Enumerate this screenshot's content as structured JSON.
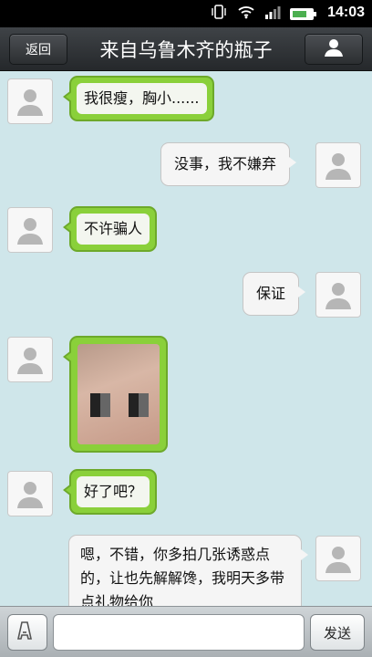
{
  "status_bar": {
    "time": "14:03",
    "icons": [
      "vibrate-icon",
      "wifi-icon",
      "signal-icon",
      "battery-icon"
    ]
  },
  "header": {
    "back_label": "返回",
    "title": "来自乌鲁木齐的瓶子",
    "profile_icon": "person-icon"
  },
  "messages": [
    {
      "side": "in",
      "text": "我很瘦，胸小......"
    },
    {
      "side": "out",
      "text": "没事，我不嫌弃"
    },
    {
      "side": "in",
      "text": "不许骗人"
    },
    {
      "side": "out",
      "text": "保证"
    },
    {
      "side": "in",
      "type": "image"
    },
    {
      "side": "in",
      "text": "好了吧？"
    },
    {
      "side": "out",
      "text": "嗯，不错，你多拍几张诱惑点的，让也先解解馋，我明天多带点礼物给你"
    }
  ],
  "input_bar": {
    "voice_icon": "keyboard-voice-icon",
    "placeholder": "",
    "send_label": "发送"
  },
  "colors": {
    "background": "#cfe6ea",
    "incoming_bubble": "#8ad03a",
    "outgoing_bubble": "#f5f5f5",
    "header": "#2f3336"
  }
}
